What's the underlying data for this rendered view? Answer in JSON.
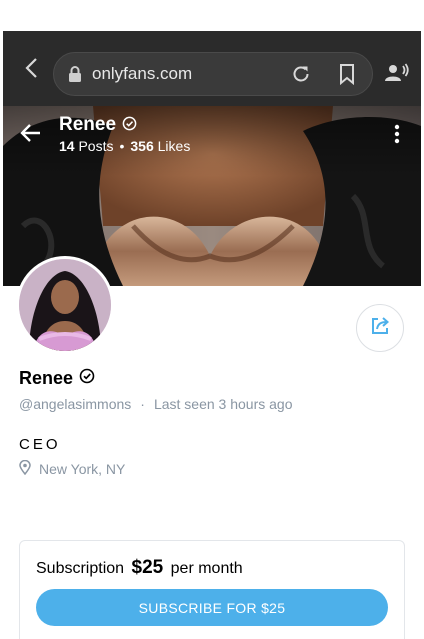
{
  "browser": {
    "url": "onlyfans.com",
    "icons": [
      "chevron-left-icon",
      "lock-icon",
      "reload-icon",
      "bookmark-icon",
      "voice-icon"
    ]
  },
  "cover": {
    "name": "Renee",
    "posts_count": "14",
    "posts_label": "Posts",
    "bullet": "•",
    "likes_count": "356",
    "likes_label": "Likes"
  },
  "profile": {
    "name": "Renee",
    "handle": "@angelasimmons",
    "separator": "·",
    "last_seen": "Last seen 3 hours ago",
    "bio": "CEO",
    "location": "New York, NY"
  },
  "subscription": {
    "prefix": "Subscription",
    "price": "$25",
    "suffix": "per month",
    "button_label": "SUBSCRIBE FOR $25"
  },
  "colors": {
    "accent": "#4db0ea",
    "muted_text": "#8a96a3",
    "browser_bg": "#2b2b2b"
  }
}
